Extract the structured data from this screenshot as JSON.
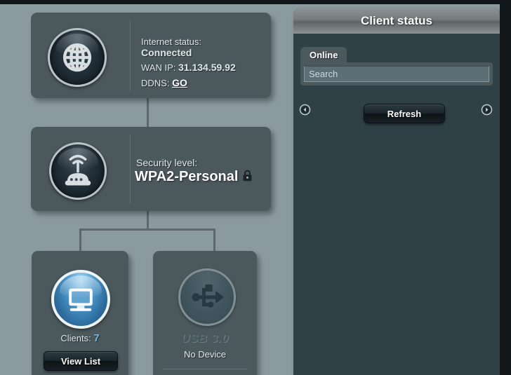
{
  "network_map": {
    "internet": {
      "status_label": "Internet status:",
      "status_value": "Connected",
      "wan_label": "WAN IP:",
      "wan_value": "31.134.59.92",
      "ddns_label": "DDNS:",
      "ddns_link": "GO",
      "icon": "globe-icon"
    },
    "security": {
      "label": "Security level:",
      "value": "WPA2-Personal",
      "lock_icon": "lock-icon",
      "icon": "router-icon"
    },
    "clients": {
      "label": "Clients:",
      "count": "7",
      "button_label": "View List",
      "icon": "monitor-icon"
    },
    "usb": {
      "title": "USB 3.0",
      "status": "No Device",
      "icon": "usb-icon"
    }
  },
  "client_status": {
    "title": "Client status",
    "tab_label": "Online",
    "search_placeholder": "Search",
    "search_value": "",
    "refresh_label": "Refresh",
    "prev_icon": "arrow-left-circle-icon",
    "next_icon": "arrow-right-circle-icon"
  },
  "colors": {
    "panel": "#4b585c",
    "page_background": "#8b9a9e",
    "accent_blue": "#6fb8e6",
    "client_panel": "#2f4047"
  }
}
